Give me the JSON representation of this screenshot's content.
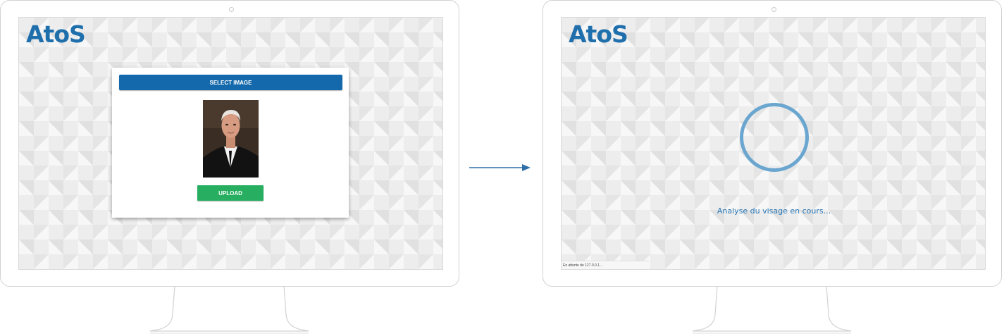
{
  "left_screen": {
    "logo": "AtoS",
    "select_button_label": "SELECT IMAGE",
    "upload_button_label": "UPLOAD"
  },
  "right_screen": {
    "logo": "AtoS",
    "status_text": "Analyse du visage en cours...",
    "statusbar_text": "En attente de 127.0.0.1..."
  },
  "colors": {
    "brand_blue": "#1f6fad",
    "select_button": "#1369ab",
    "upload_button": "#27ae60",
    "spinner": "#6aa6cf"
  },
  "icons": [
    "camera-icon",
    "arrow-right-icon",
    "loading-spinner-icon"
  ]
}
